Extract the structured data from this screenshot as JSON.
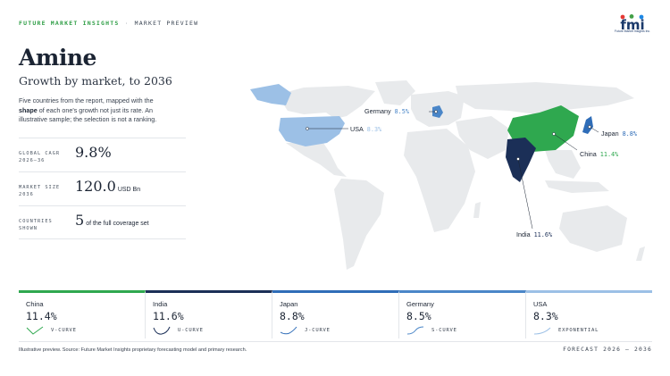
{
  "header": {
    "brand": "FUTURE MARKET INSIGHTS",
    "separator": "·",
    "section": "MARKET PREVIEW",
    "logo_text": "fmi",
    "logo_sub": "Future Market Insights Inc."
  },
  "title": "Amine",
  "subtitle": "Growth by market, to 2036",
  "description": {
    "part1": "Five countries from the report, mapped with the ",
    "bold": "shape",
    "part2": " of each one's growth not just its rate. An illustrative sample; the selection is not a ranking."
  },
  "stats": [
    {
      "label": "GLOBAL CAGR 2026–36",
      "value": "9.8%",
      "unit": ""
    },
    {
      "label": "MARKET SIZE 2036",
      "value": "120.0",
      "unit": "USD Bn"
    },
    {
      "label": "COUNTRIES SHOWN",
      "value": "5",
      "unit": "of the full coverage set"
    }
  ],
  "map_callouts": {
    "germany": {
      "name": "Germany",
      "pct": "8.5%"
    },
    "usa": {
      "name": "USA",
      "pct": "8.3%"
    },
    "japan": {
      "name": "Japan",
      "pct": "8.8%"
    },
    "china": {
      "name": "China",
      "pct": "11.4%"
    },
    "india": {
      "name": "India",
      "pct": "11.6%"
    }
  },
  "countries": [
    {
      "name": "China",
      "value": "11.4%",
      "curve": "V-CURVE",
      "color": "#2fa84f"
    },
    {
      "name": "India",
      "value": "11.6%",
      "curve": "U-CURVE",
      "color": "#1b2f57"
    },
    {
      "name": "Japan",
      "value": "8.8%",
      "curve": "J-CURVE",
      "color": "#2f6db8"
    },
    {
      "name": "Germany",
      "value": "8.5%",
      "curve": "S-CURVE",
      "color": "#4a86c8"
    },
    {
      "name": "USA",
      "value": "8.3%",
      "curve": "EXPONENTIAL",
      "color": "#9cc0e6"
    }
  ],
  "footer": {
    "note": "Illustrative preview. Source: Future Market Insights proprietary forecasting model and primary research.",
    "forecast": "FORECAST 2026 – 2036"
  },
  "colors": {
    "accent_green": "#2fa84f",
    "india_navy": "#1b2f57",
    "japan_blue": "#2f6db8",
    "germany_blue": "#4a86c8",
    "usa_light": "#9cc0e6",
    "land_gray": "#e8eaec"
  }
}
